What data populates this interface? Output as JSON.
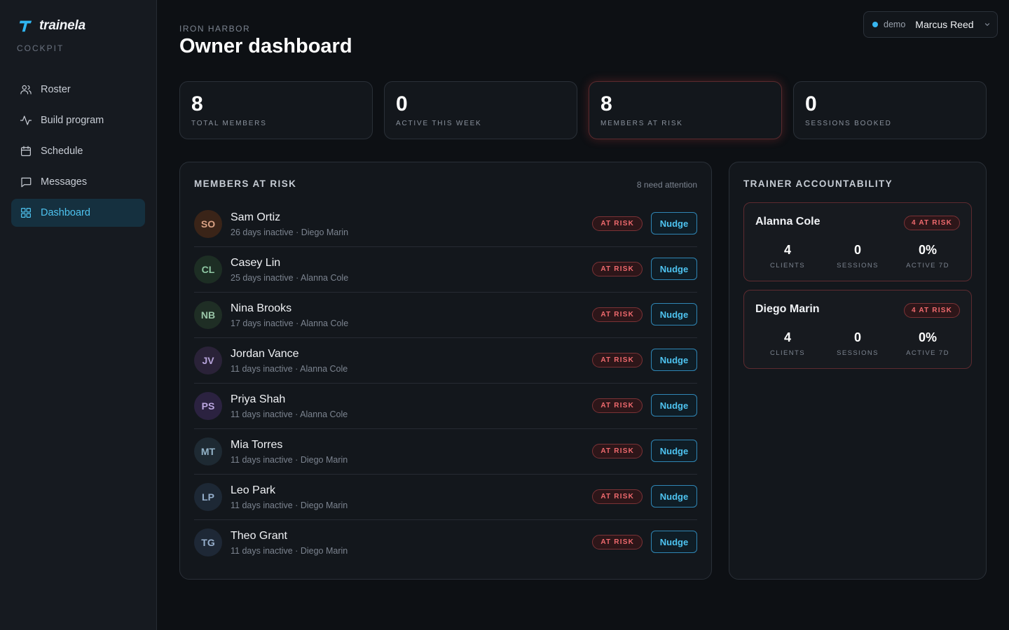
{
  "brand": {
    "name": "trainela",
    "sub": "COCKPIT"
  },
  "nav": [
    {
      "label": "Roster",
      "icon": "users-icon",
      "active": false
    },
    {
      "label": "Build program",
      "icon": "activity-icon",
      "active": false
    },
    {
      "label": "Schedule",
      "icon": "calendar-icon",
      "active": false
    },
    {
      "label": "Messages",
      "icon": "message-icon",
      "active": false
    },
    {
      "label": "Dashboard",
      "icon": "grid-icon",
      "active": true
    }
  ],
  "header": {
    "crumb": "IRON HARBOR",
    "title": "Owner dashboard"
  },
  "user": {
    "env": "demo",
    "name": "Marcus Reed"
  },
  "stats": [
    {
      "value": "8",
      "label": "TOTAL MEMBERS"
    },
    {
      "value": "0",
      "label": "ACTIVE THIS WEEK"
    },
    {
      "value": "8",
      "label": "MEMBERS AT RISK"
    },
    {
      "value": "0",
      "label": "SESSIONS BOOKED"
    }
  ],
  "risk": {
    "title": "MEMBERS AT RISK",
    "meta": "8 need attention",
    "badge": "AT RISK",
    "nudge": "Nudge",
    "members": [
      {
        "initials": "SO",
        "name": "Sam Ortiz",
        "sub": "26 days inactive · Diego Marin",
        "bg": "#3a2418",
        "fg": "#d9a184"
      },
      {
        "initials": "CL",
        "name": "Casey Lin",
        "sub": "25 days inactive · Alanna Cole",
        "bg": "#1d2e24",
        "fg": "#8fc7a3"
      },
      {
        "initials": "NB",
        "name": "Nina Brooks",
        "sub": "17 days inactive · Alanna Cole",
        "bg": "#1f2e25",
        "fg": "#9ac6a8"
      },
      {
        "initials": "JV",
        "name": "Jordan Vance",
        "sub": "11 days inactive · Alanna Cole",
        "bg": "#2a2238",
        "fg": "#b6a3da"
      },
      {
        "initials": "PS",
        "name": "Priya Shah",
        "sub": "11 days inactive · Alanna Cole",
        "bg": "#2b2240",
        "fg": "#bba6e0"
      },
      {
        "initials": "MT",
        "name": "Mia Torres",
        "sub": "11 days inactive · Diego Marin",
        "bg": "#1e2a33",
        "fg": "#93b3c8"
      },
      {
        "initials": "LP",
        "name": "Leo Park",
        "sub": "11 days inactive · Diego Marin",
        "bg": "#1d2835",
        "fg": "#94aecb"
      },
      {
        "initials": "TG",
        "name": "Theo Grant",
        "sub": "11 days inactive · Diego Marin",
        "bg": "#1e2836",
        "fg": "#97afcc"
      }
    ]
  },
  "trainers": {
    "title": "TRAINER ACCOUNTABILITY",
    "items": [
      {
        "name": "Alanna Cole",
        "badge": "4 AT RISK",
        "stats": [
          {
            "value": "4",
            "label": "CLIENTS"
          },
          {
            "value": "0",
            "label": "SESSIONS"
          },
          {
            "value": "0%",
            "label": "ACTIVE 7D"
          }
        ]
      },
      {
        "name": "Diego Marin",
        "badge": "4 AT RISK",
        "stats": [
          {
            "value": "4",
            "label": "CLIENTS"
          },
          {
            "value": "0",
            "label": "SESSIONS"
          },
          {
            "value": "0%",
            "label": "ACTIVE 7D"
          }
        ]
      }
    ]
  },
  "colors": {
    "accent": "#4ec3f0",
    "danger": "#f06a6e",
    "bg": "#0d1014",
    "panel": "#13171c"
  }
}
